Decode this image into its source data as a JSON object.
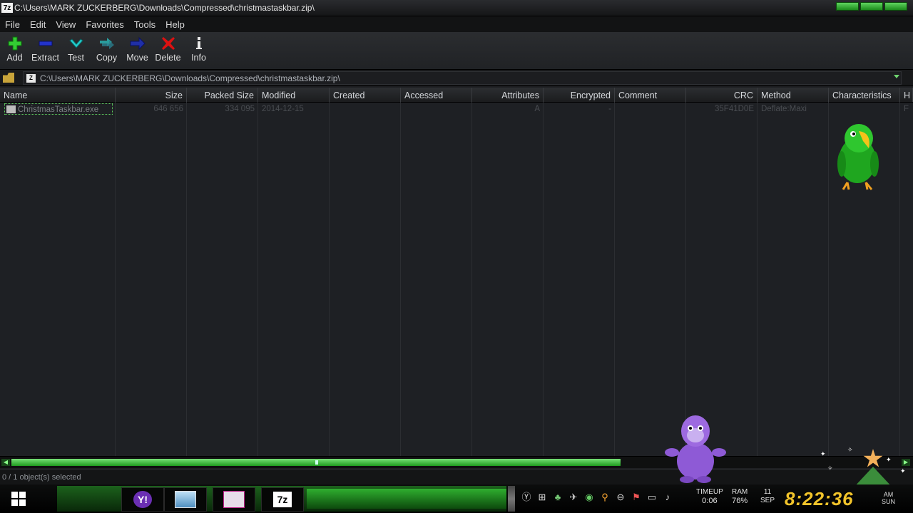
{
  "window": {
    "title": "C:\\Users\\MARK ZUCKERBERG\\Downloads\\Compressed\\christmastaskbar.zip\\",
    "app_icon_label": "7z"
  },
  "menu": [
    "File",
    "Edit",
    "View",
    "Favorites",
    "Tools",
    "Help"
  ],
  "toolbar": [
    {
      "label": "Add",
      "icon": "plus-icon",
      "color": "#33cc33"
    },
    {
      "label": "Extract",
      "icon": "minus-icon",
      "color": "#2233cc"
    },
    {
      "label": "Test",
      "icon": "check-icon",
      "color": "#22cccc"
    },
    {
      "label": "Copy",
      "icon": "double-arrow-icon",
      "color": "#2a9d9d"
    },
    {
      "label": "Move",
      "icon": "arrow-right-icon",
      "color": "#1f2fa8"
    },
    {
      "label": "Delete",
      "icon": "x-icon",
      "color": "#dd1111"
    },
    {
      "label": "Info",
      "icon": "info-icon",
      "color": "#e8e8e8"
    }
  ],
  "address": {
    "path": "C:\\Users\\MARK ZUCKERBERG\\Downloads\\Compressed\\christmastaskbar.zip\\",
    "zip_icon_label": "Z"
  },
  "columns": [
    "Name",
    "Size",
    "Packed Size",
    "Modified",
    "Created",
    "Accessed",
    "Attributes",
    "Encrypted",
    "Comment",
    "CRC",
    "Method",
    "Characteristics",
    "H"
  ],
  "files": [
    {
      "name": "ChristmasTaskbar.exe",
      "size": "646 656",
      "packed_size": "334 095",
      "modified": "2014-12-15",
      "created": "",
      "accessed": "",
      "attributes": "A",
      "encrypted": "-",
      "comment": "",
      "crc": "35F41D0E",
      "method": "Deflate:Maxi",
      "characteristics": "",
      "h": "F"
    }
  ],
  "status": {
    "selection": "0 / 1 object(s) selected"
  },
  "taskbar": {
    "apps": [
      {
        "name": "yahoo-messenger",
        "label": "Y!"
      },
      {
        "name": "screen",
        "label": ""
      },
      {
        "name": "mail",
        "label": ""
      },
      {
        "name": "7zip",
        "label": "7z"
      }
    ],
    "tray_icons": [
      "yandex-icon",
      "network-icon",
      "tree-icon",
      "bird-icon",
      "globe-icon",
      "search-icon",
      "minus-circle-icon",
      "flag-icon",
      "monitor-icon",
      "speaker-icon"
    ],
    "timeup_label": "TIMEUP",
    "timeup_value": "0:06",
    "ram_label": "RAM",
    "ram_value": "76%",
    "day": "11",
    "month": "SEP",
    "clock": "8:22:36",
    "ampm": "AM",
    "weekday": "SUN"
  },
  "colors": {
    "accent": "#33cc33",
    "clock": "#f2c42b"
  }
}
